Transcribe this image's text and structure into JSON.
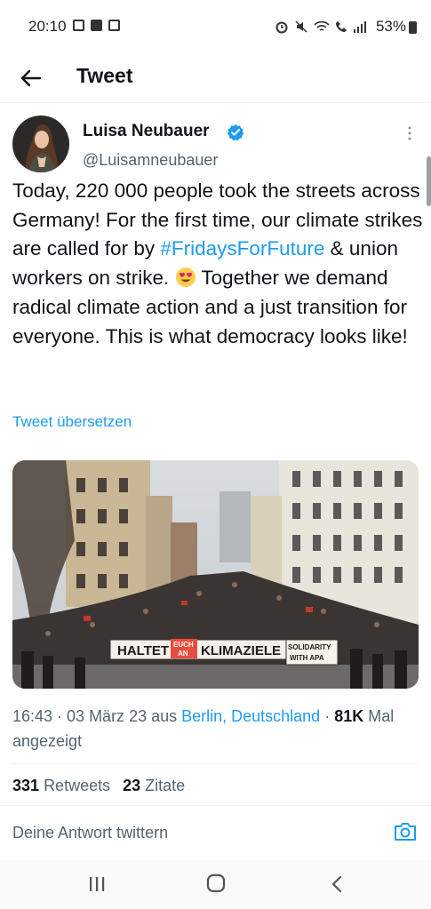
{
  "status": {
    "time": "20:10",
    "battery": "53%"
  },
  "header": {
    "title": "Tweet"
  },
  "tweet": {
    "author_name": "Luisa Neubauer",
    "author_handle": "@Luisamneubauer",
    "text_part1": "Today, 220 000 people took the streets across Germany! For the first time, our climate strikes are called for by ",
    "hashtag": "#FridaysForFuture",
    "text_part2": " & union workers on strike. ",
    "emoji": "heart-eyes-emoji",
    "text_part3": " Together we demand radical climate action and a just transition for everyone. This is what democracy looks like!",
    "translate_label": "Tweet übersetzen",
    "photo_banner": {
      "left": "HALTET",
      "middle_top": "EUCH",
      "middle_bottom": "AN",
      "right": "KLIMAZIELE",
      "sign_line1": "SOLIDARITY",
      "sign_line2": "WITH APA"
    },
    "timestamp": "16:43 · 03 März 23 aus ",
    "location": "Berlin, Deutschland",
    "views_sep": " · ",
    "views_count": "81K",
    "views_label": " Mal angezeigt"
  },
  "stats": {
    "retweets_count": "331",
    "retweets_label": "Retweets",
    "quotes_count": "23",
    "quotes_label": "Zitate"
  },
  "reply": {
    "placeholder": "Deine Antwort twittern"
  },
  "colors": {
    "accent": "#1d9bf0",
    "text": "#0f1419",
    "muted": "#536471"
  }
}
